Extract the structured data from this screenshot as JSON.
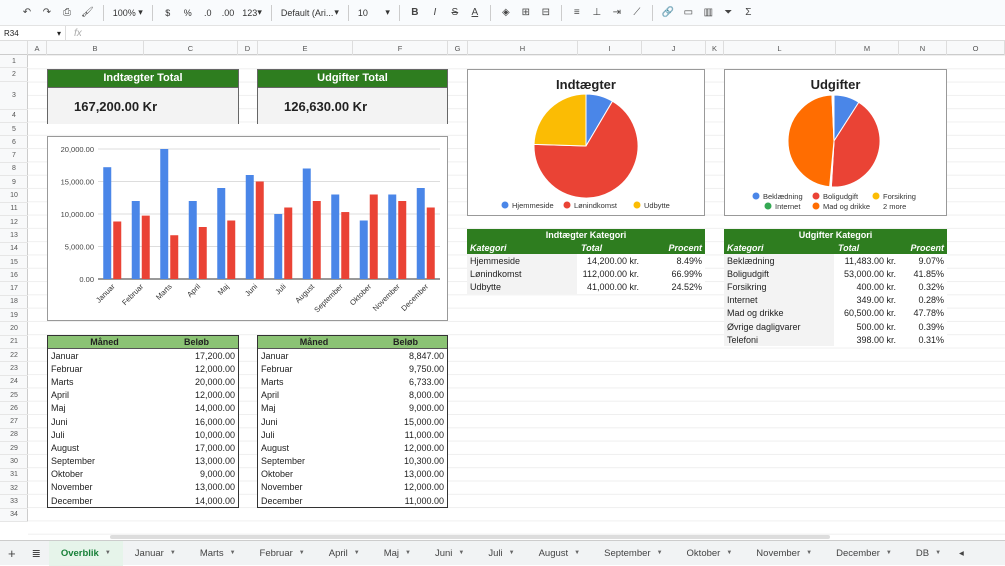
{
  "toolbar": {
    "zoom": "100%",
    "currency": "$",
    "percent": "%",
    "dec_less": ".0",
    "dec_more": ".00",
    "fmt": "123",
    "font": "Default (Ari...",
    "size": "10",
    "bold": "B",
    "italic": "I",
    "strike": "S",
    "color": "A"
  },
  "formula": {
    "cell": "R34",
    "fx": "fx"
  },
  "columns": [
    "A",
    "B",
    "C",
    "D",
    "E",
    "F",
    "G",
    "H",
    "I",
    "J",
    "K",
    "L",
    "M",
    "N",
    "O"
  ],
  "rows": [
    "1",
    "2",
    "3",
    "4",
    "5",
    "6",
    "7",
    "8",
    "9",
    "10",
    "11",
    "12",
    "13",
    "14",
    "15",
    "16",
    "17",
    "18",
    "19",
    "20",
    "21",
    "22",
    "23",
    "24",
    "25",
    "26",
    "27",
    "28",
    "29",
    "30",
    "31",
    "32",
    "33",
    "34"
  ],
  "income_total": {
    "label": "Indtægter  Total",
    "value": "167,200.00 Kr"
  },
  "expense_total": {
    "label": "Udgifter  Total",
    "value": "126,630.00 Kr"
  },
  "chart_data": [
    {
      "type": "bar",
      "categories": [
        "Januar",
        "Februar",
        "Marts",
        "April",
        "Maj",
        "Juni",
        "Juli",
        "August",
        "September",
        "Oktober",
        "November",
        "December"
      ],
      "series": [
        {
          "values": [
            17200,
            12000,
            20000,
            12000,
            14000,
            16000,
            10000,
            17000,
            13000,
            9000,
            13000,
            14000
          ],
          "color": "#4a86e8"
        },
        {
          "values": [
            8847,
            9750,
            6733,
            8000,
            9000,
            15000,
            11000,
            12000,
            10300,
            13000,
            12000,
            11000
          ],
          "color": "#ea4335"
        }
      ],
      "ylim": [
        0,
        20000
      ],
      "yticks": [
        "0.00",
        "5,000.00",
        "10,000.00",
        "15,000.00",
        "20,000.00"
      ]
    },
    {
      "type": "pie",
      "title": "Indtægter",
      "labels": [
        "Hjemmeside",
        "Lønindkomst",
        "Udbytte"
      ],
      "values": [
        14200,
        112000,
        41000
      ],
      "colors": [
        "#4a86e8",
        "#ea4335",
        "#fbbc04"
      ]
    },
    {
      "type": "pie",
      "title": "Udgifter",
      "labels": [
        "Beklædning",
        "Boligudgift",
        "Forsikring",
        "Internet",
        "Mad og drikke",
        "Øvrige dagligvarer",
        "Telefoni"
      ],
      "values": [
        11483,
        53000,
        400,
        349,
        60500,
        500,
        398
      ],
      "colors": [
        "#4a86e8",
        "#ea4335",
        "#fbbc04",
        "#34a853",
        "#ff6d01",
        "#46bdc6",
        "#7baaf7"
      ],
      "legend_more": "2 more"
    }
  ],
  "income_table": {
    "h1": "Måned",
    "h2": "Beløb",
    "rows": [
      [
        "Januar",
        "17,200.00"
      ],
      [
        "Februar",
        "12,000.00"
      ],
      [
        "Marts",
        "20,000.00"
      ],
      [
        "April",
        "12,000.00"
      ],
      [
        "Maj",
        "14,000.00"
      ],
      [
        "Juni",
        "16,000.00"
      ],
      [
        "Juli",
        "10,000.00"
      ],
      [
        "August",
        "17,000.00"
      ],
      [
        "September",
        "13,000.00"
      ],
      [
        "Oktober",
        "9,000.00"
      ],
      [
        "November",
        "13,000.00"
      ],
      [
        "December",
        "14,000.00"
      ]
    ]
  },
  "expense_table": {
    "h1": "Måned",
    "h2": "Beløb",
    "rows": [
      [
        "Januar",
        "8,847.00"
      ],
      [
        "Februar",
        "9,750.00"
      ],
      [
        "Marts",
        "6,733.00"
      ],
      [
        "April",
        "8,000.00"
      ],
      [
        "Maj",
        "9,000.00"
      ],
      [
        "Juni",
        "15,000.00"
      ],
      [
        "Juli",
        "11,000.00"
      ],
      [
        "August",
        "12,000.00"
      ],
      [
        "September",
        "10,300.00"
      ],
      [
        "Oktober",
        "13,000.00"
      ],
      [
        "November",
        "12,000.00"
      ],
      [
        "December",
        "11,000.00"
      ]
    ]
  },
  "income_cat": {
    "title": "Indtægter  Kategori",
    "h": [
      "Kategori",
      "Total",
      "Procent"
    ],
    "rows": [
      [
        "Hjemmeside",
        "14,200.00 kr.",
        "8.49%"
      ],
      [
        "Lønindkomst",
        "112,000.00 kr.",
        "66.99%"
      ],
      [
        "Udbytte",
        "41,000.00 kr.",
        "24.52%"
      ]
    ]
  },
  "expense_cat": {
    "title": "Udgifter  Kategori",
    "h": [
      "Kategori",
      "Total",
      "Procent"
    ],
    "rows": [
      [
        "Beklædning",
        "11,483.00 kr.",
        "9.07%"
      ],
      [
        "Boligudgift",
        "53,000.00 kr.",
        "41.85%"
      ],
      [
        "Forsikring",
        "400.00 kr.",
        "0.32%"
      ],
      [
        "Internet",
        "349.00 kr.",
        "0.28%"
      ],
      [
        "Mad og drikke",
        "60,500.00 kr.",
        "47.78%"
      ],
      [
        "Øvrige dagligvarer",
        "500.00 kr.",
        "0.39%"
      ],
      [
        "Telefoni",
        "398.00 kr.",
        "0.31%"
      ]
    ]
  },
  "tabs": [
    "Overblik",
    "Januar",
    "Marts",
    "Februar",
    "April",
    "Maj",
    "Juni",
    "Juli",
    "August",
    "September",
    "Oktober",
    "November",
    "December",
    "DB"
  ]
}
